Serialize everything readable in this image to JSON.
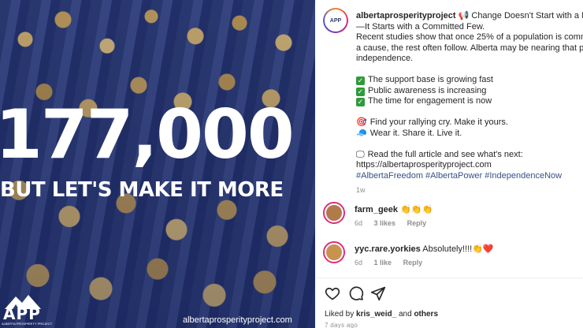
{
  "image": {
    "big_number": "177,000",
    "subline": "BUT LET'S MAKE IT MORE",
    "logo_text": "APP",
    "logo_small": "ALBERTA PROSPERITY PROJECT",
    "site_url": "albertaprosperityproject.com"
  },
  "post": {
    "username": "albertaprosperityproject",
    "headline_emoji": "📢",
    "headline_1": "Change Doesn't Start with a Majori",
    "headline_2": "—It Starts with a Committed Few.",
    "body_1": "Recent studies show that once 25% of a population is committe",
    "body_2": "a cause, the rest often follow. Alberta may be nearing that point",
    "body_3": "independence.",
    "checks": [
      "The support base is growing fast",
      "Public awareness is increasing",
      "The time for engagement is now"
    ],
    "rally_1_emoji": "🎯",
    "rally_1": "Find your rallying cry. Make it yours.",
    "rally_2_emoji": "🧢",
    "rally_2": "Wear it. Share it. Live it.",
    "read_emoji": "🖵",
    "read_1": "Read the full article and see what's next:",
    "read_url": "https://albertaprosperityproject.com",
    "hashtags": "#AlbertaFreedom #AlbertaPower #IndependenceNow",
    "time": "1w"
  },
  "comments": [
    {
      "username": "farm_geek",
      "text": "👏👏👏",
      "age": "6d",
      "likes": "3 likes",
      "reply": "Reply"
    },
    {
      "username": "yyc.rare.yorkies",
      "text": "Absolutely!!!!👏❤️",
      "age": "6d",
      "likes": "1 like",
      "reply": "Reply"
    }
  ],
  "footer": {
    "liked_prefix": "Liked by",
    "liked_user": "kris_weid_",
    "liked_and": "and",
    "liked_others": "others",
    "ago": "7 days ago"
  },
  "icons": {
    "like": "heart-icon",
    "comment": "comment-icon",
    "share": "share-icon"
  }
}
